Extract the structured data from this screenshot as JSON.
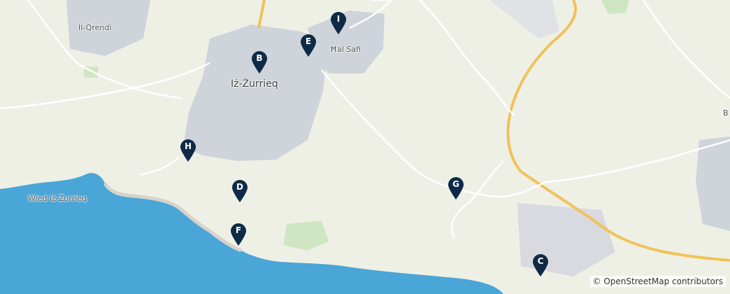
{
  "map": {
    "colors": {
      "land": "#eef0e6",
      "sea": "#4aa6d6",
      "urban": "#cfd3da",
      "major_road": "#f1c25a",
      "minor_road": "#ffffff",
      "green": "#cfe6c2",
      "marker": "#0e2a47"
    },
    "places": [
      {
        "id": "il-qrendi",
        "label": "Il-Qrendi"
      },
      {
        "id": "iz-zurrieq",
        "label": "Iż-Żurrieq"
      },
      {
        "id": "hal-safi",
        "label": "Ħal Safi"
      },
      {
        "id": "wied-iz-zurrieq",
        "label": "Wied iż-Żurrieq"
      },
      {
        "id": "b-partial",
        "label": "B"
      }
    ],
    "markers": [
      {
        "id": "A",
        "label": "I"
      },
      {
        "id": "B",
        "label": "E"
      },
      {
        "id": "C",
        "label": "B"
      },
      {
        "id": "D",
        "label": "H"
      },
      {
        "id": "E",
        "label": "D"
      },
      {
        "id": "F",
        "label": "G"
      },
      {
        "id": "G",
        "label": "F"
      },
      {
        "id": "H",
        "label": "C"
      }
    ],
    "attribution": "© OpenStreetMap contributors"
  }
}
